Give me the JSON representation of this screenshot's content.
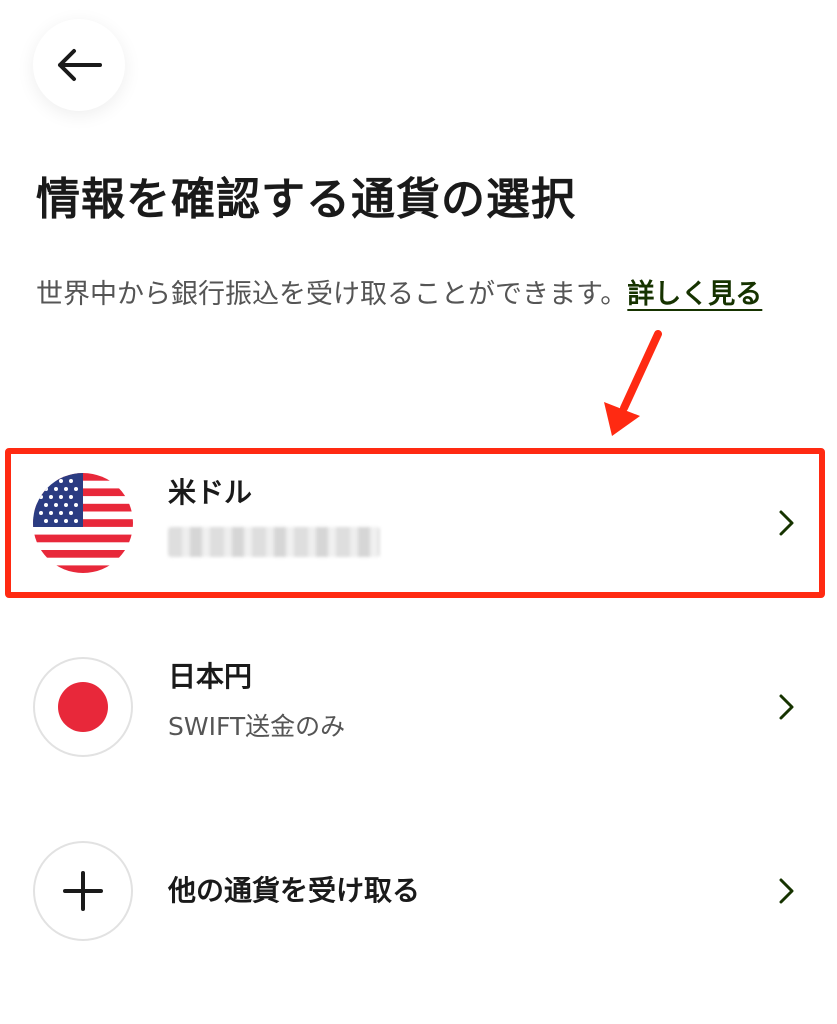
{
  "header": {
    "back_icon": "arrow-left-icon"
  },
  "page": {
    "title": "情報を確認する通貨の選択",
    "subtitle": "世界中から銀行振込を受け取ることができます。",
    "learn_more": "詳しく見る"
  },
  "currencies": [
    {
      "name": "米ドル",
      "detail": "",
      "icon": "us-flag-icon",
      "highlighted": true
    },
    {
      "name": "日本円",
      "detail": "SWIFT送金のみ",
      "icon": "japan-flag-icon"
    },
    {
      "name": "他の通貨を受け取る",
      "icon": "plus-icon"
    }
  ],
  "colors": {
    "accent_text": "#163300",
    "highlight": "#ff2a12",
    "chevron": "#163300"
  }
}
